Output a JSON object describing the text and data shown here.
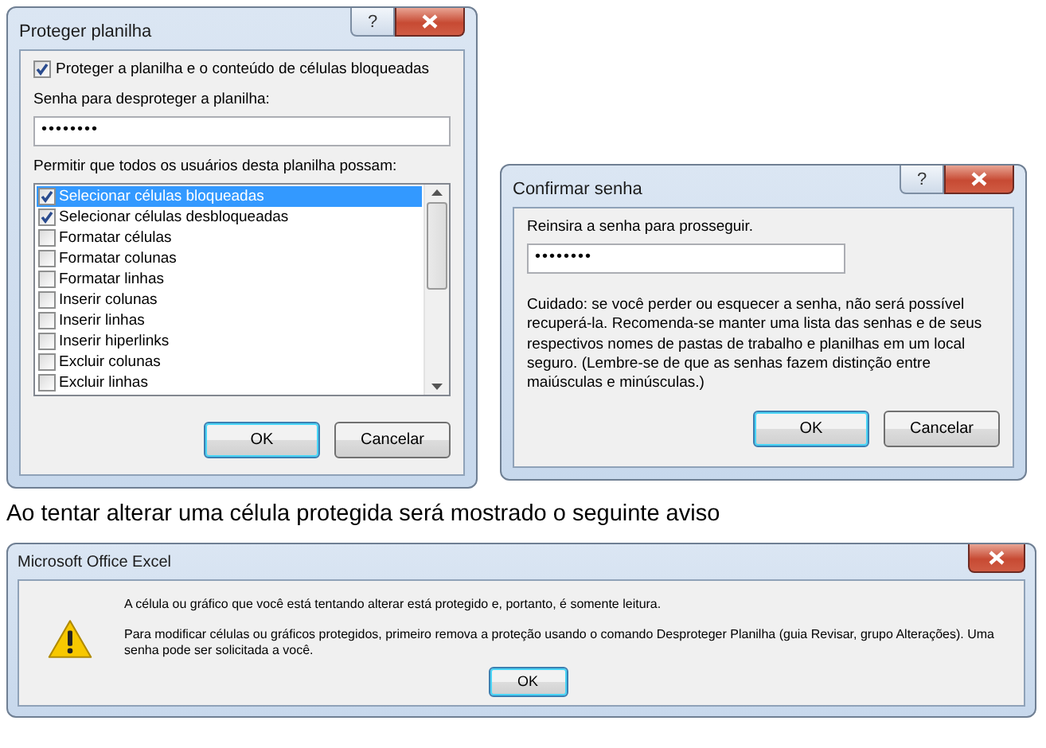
{
  "protect_dialog": {
    "title": "Proteger planilha",
    "help_glyph": "?",
    "protect_option": {
      "label": "Proteger a planilha e o conteúdo de células bloqueadas",
      "checked": true
    },
    "password_label": "Senha para desproteger a planilha:",
    "password_value": "••••••••",
    "permissions_label": "Permitir que todos os usuários desta planilha possam:",
    "permissions": [
      {
        "label": "Selecionar células bloqueadas",
        "checked": true,
        "selected": true
      },
      {
        "label": "Selecionar células desbloqueadas",
        "checked": true,
        "selected": false
      },
      {
        "label": "Formatar células",
        "checked": false,
        "selected": false
      },
      {
        "label": "Formatar colunas",
        "checked": false,
        "selected": false
      },
      {
        "label": "Formatar linhas",
        "checked": false,
        "selected": false
      },
      {
        "label": "Inserir colunas",
        "checked": false,
        "selected": false
      },
      {
        "label": "Inserir linhas",
        "checked": false,
        "selected": false
      },
      {
        "label": "Inserir hiperlinks",
        "checked": false,
        "selected": false
      },
      {
        "label": "Excluir colunas",
        "checked": false,
        "selected": false
      },
      {
        "label": "Excluir linhas",
        "checked": false,
        "selected": false
      }
    ],
    "buttons": [
      {
        "label": "OK",
        "default": true
      },
      {
        "label": "Cancelar",
        "default": false
      }
    ]
  },
  "confirm_dialog": {
    "title": "Confirmar senha",
    "help_glyph": "?",
    "prompt": "Reinsira a senha para prosseguir.",
    "password_value": "••••••••",
    "warning": "Cuidado: se você perder ou esquecer a senha, não será possível recuperá-la. Recomenda-se manter uma lista das senhas e de seus respectivos nomes de pastas de trabalho e planilhas em um local seguro. (Lembre-se de que as senhas fazem distinção entre maiúsculas e minúsculas.)",
    "buttons": [
      {
        "label": "OK",
        "default": true
      },
      {
        "label": "Cancelar",
        "default": false
      }
    ]
  },
  "caption": "Ao tentar alterar uma célula protegida será mostrado o seguinte aviso",
  "alert_dialog": {
    "title": "Microsoft Office Excel",
    "messages": [
      "A célula ou gráfico que você está tentando alterar está protegido e, portanto, é somente leitura.",
      "Para modificar células ou gráficos protegidos, primeiro remova a proteção usando o comando Desproteger Planilha (guia Revisar, grupo Alterações). Uma senha pode ser solicitada a você."
    ],
    "buttons": [
      {
        "label": "OK",
        "default": true
      }
    ]
  }
}
